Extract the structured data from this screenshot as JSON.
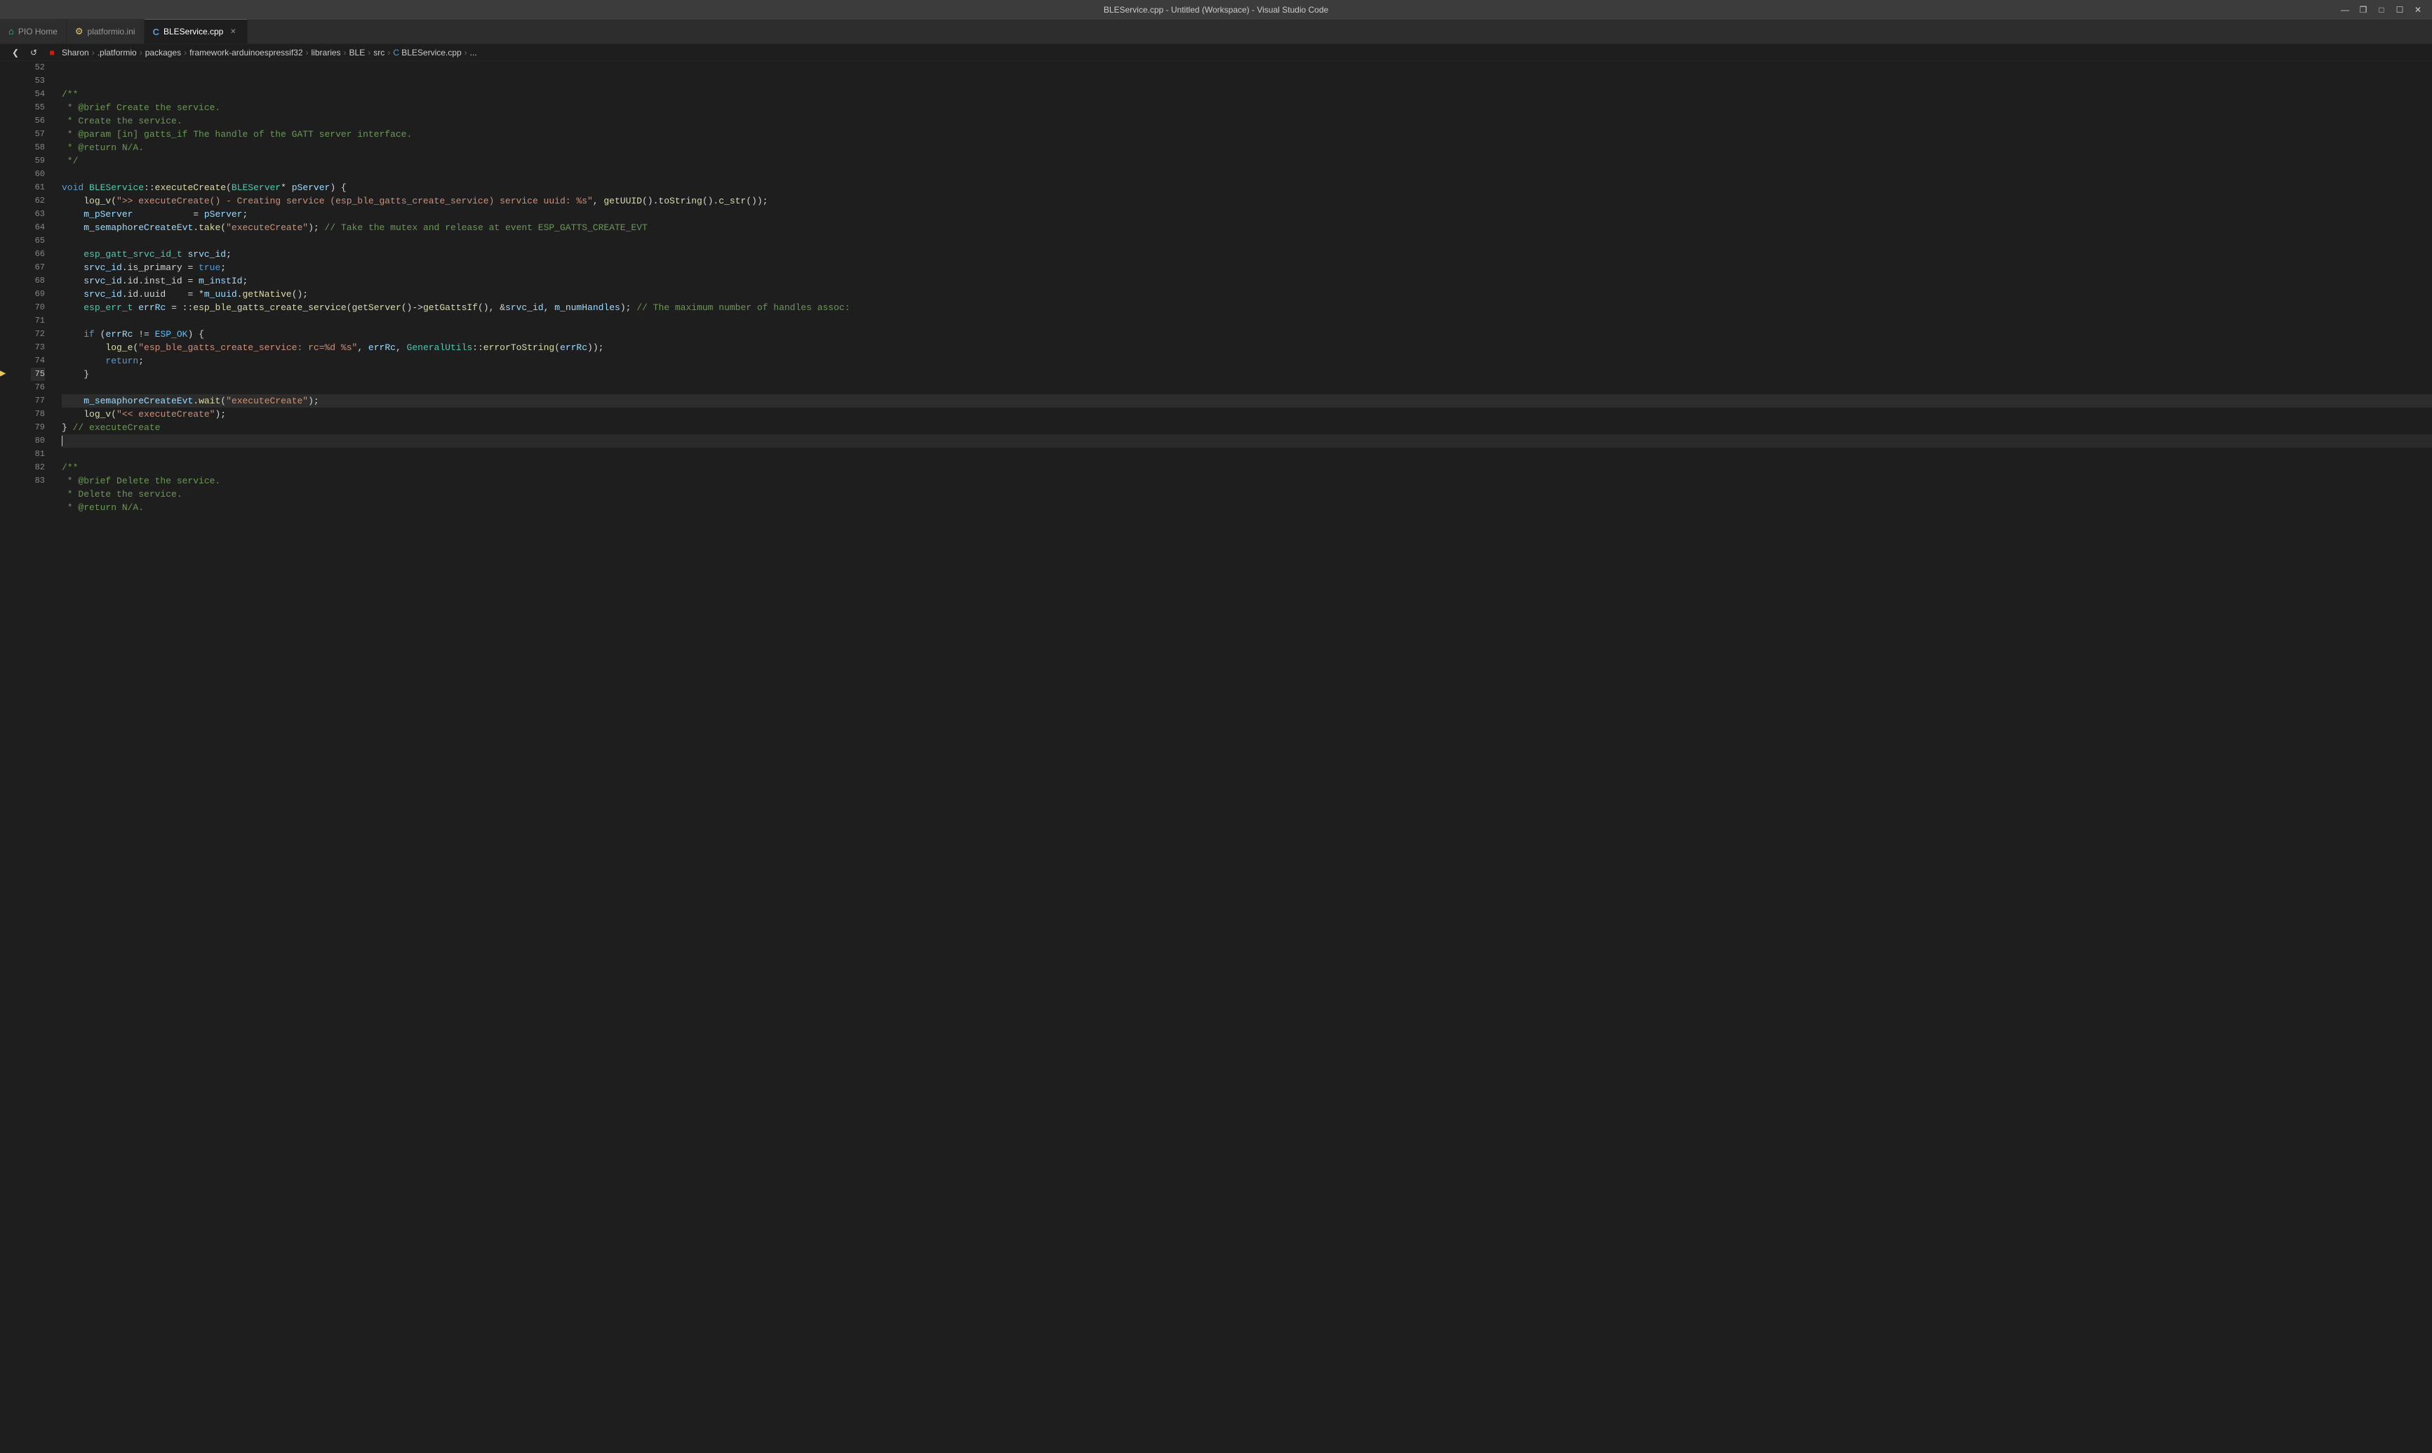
{
  "titleBar": {
    "title": "BLEService.cpp - Untitled (Workspace) - Visual Studio Code",
    "controls": [
      "minimize",
      "maximize",
      "close"
    ]
  },
  "tabs": [
    {
      "id": "pio-home",
      "label": "PIO Home",
      "icon": "🏠",
      "active": false,
      "closable": false
    },
    {
      "id": "platformio-ini",
      "label": "platformio.ini",
      "icon": "⚙",
      "active": false,
      "closable": false
    },
    {
      "id": "ble-service",
      "label": "BLEService.cpp",
      "icon": "C",
      "active": true,
      "closable": true
    }
  ],
  "breadcrumb": {
    "parts": [
      "Sharon",
      ".platformio",
      "packages",
      "framework-arduinoespressif32",
      "libraries",
      "BLE",
      "src",
      "BLEService.cpp",
      "..."
    ]
  },
  "lines": [
    {
      "num": 52,
      "content": "/**",
      "type": "comment"
    },
    {
      "num": 53,
      "content": " * @brief Create the service.",
      "type": "comment"
    },
    {
      "num": 54,
      "content": " * Create the service.",
      "type": "comment"
    },
    {
      "num": 55,
      "content": " * @param [in] gatts_if The handle of the GATT server interface.",
      "type": "comment"
    },
    {
      "num": 56,
      "content": " * @return N/A.",
      "type": "comment"
    },
    {
      "num": 57,
      "content": " */",
      "type": "comment"
    },
    {
      "num": 58,
      "content": "",
      "type": "blank"
    },
    {
      "num": 59,
      "content": "void BLEService::executeCreate(BLEServer* pServer) {",
      "type": "code"
    },
    {
      "num": 60,
      "content": "    log_v(\">\\> executeCreate() - Creating service (esp_ble_gatts_create_service) service uuid: %s\", getUUID().toString().c_str());",
      "type": "code"
    },
    {
      "num": 61,
      "content": "    m_pServer           = pServer;",
      "type": "code"
    },
    {
      "num": 62,
      "content": "    m_semaphoreCreateEvt.take(\"executeCreate\"); // Take the mutex and release at event ESP_GATTS_CREATE_EVT",
      "type": "code"
    },
    {
      "num": 63,
      "content": "",
      "type": "blank"
    },
    {
      "num": 64,
      "content": "    esp_gatt_srvc_id_t srvc_id;",
      "type": "code"
    },
    {
      "num": 65,
      "content": "    srvc_id.is_primary = true;",
      "type": "code"
    },
    {
      "num": 66,
      "content": "    srvc_id.id.inst_id = m_instId;",
      "type": "code"
    },
    {
      "num": 67,
      "content": "    srvc_id.id.uuid    = *m_uuid.getNative();",
      "type": "code"
    },
    {
      "num": 68,
      "content": "    esp_err_t errRc = ::esp_ble_gatts_create_service(getServer()->getGattsIf(), &srvc_id, m_numHandles); // The maximum number of handles assoc",
      "type": "code"
    },
    {
      "num": 69,
      "content": "",
      "type": "blank"
    },
    {
      "num": 70,
      "content": "    if (errRc != ESP_OK) {",
      "type": "code"
    },
    {
      "num": 71,
      "content": "        log_e(\"esp_ble_gatts_create_service: rc=%d %s\", errRc, GeneralUtils::errorToString(errRc));",
      "type": "code"
    },
    {
      "num": 72,
      "content": "        return;",
      "type": "code"
    },
    {
      "num": 73,
      "content": "    }",
      "type": "code"
    },
    {
      "num": 74,
      "content": "",
      "type": "blank"
    },
    {
      "num": 75,
      "content": "    m_semaphoreCreateEvt.wait(\"executeCreate\");",
      "type": "code",
      "highlighted": true,
      "debug": true
    },
    {
      "num": 76,
      "content": "    log_v(\"<< executeCreate\");",
      "type": "code"
    },
    {
      "num": 77,
      "content": "} // executeCreate",
      "type": "code"
    },
    {
      "num": 78,
      "content": "",
      "type": "blank",
      "cursor": true
    },
    {
      "num": 79,
      "content": "",
      "type": "blank"
    },
    {
      "num": 80,
      "content": "/**",
      "type": "comment"
    },
    {
      "num": 81,
      "content": " * @brief Delete the service.",
      "type": "comment"
    },
    {
      "num": 82,
      "content": " * Delete the service.",
      "type": "comment"
    },
    {
      "num": 83,
      "content": " * @return N/A.",
      "type": "comment"
    }
  ]
}
